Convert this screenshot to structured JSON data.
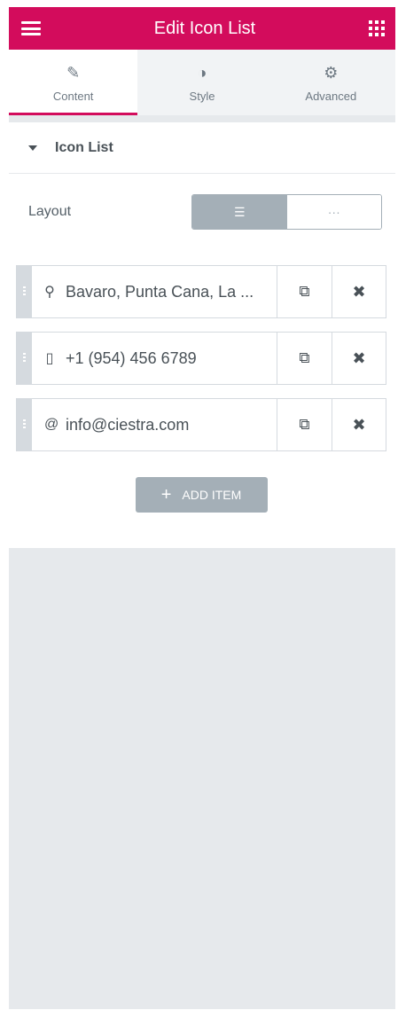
{
  "header": {
    "title": "Edit Icon List",
    "menu_icon": "hamburger-icon",
    "apps_icon": "grid-icon"
  },
  "tabs": [
    {
      "label": "Content",
      "icon": "pencil-icon",
      "active": true
    },
    {
      "label": "Style",
      "icon": "contrast-icon",
      "active": false
    },
    {
      "label": "Advanced",
      "icon": "gear-icon",
      "active": false
    }
  ],
  "section": {
    "title": "Icon List"
  },
  "layout": {
    "label": "Layout",
    "options": [
      {
        "icon": "list-icon",
        "glyph": "☰",
        "active": true
      },
      {
        "icon": "inline-dots-icon",
        "glyph": "···",
        "active": false
      }
    ]
  },
  "items": [
    {
      "icon": "map-marker-icon",
      "glyph": "⚲",
      "text": "Bavaro, Punta Cana, La ..."
    },
    {
      "icon": "mobile-icon",
      "glyph": "▯",
      "text": "+1 (954) 456 6789"
    },
    {
      "icon": "at-icon",
      "glyph": "@",
      "text": "info@ciestra.com"
    }
  ],
  "item_actions": {
    "duplicate_glyph": "⧉",
    "remove_glyph": "✖"
  },
  "add_button": {
    "label": "ADD ITEM",
    "glyph": "+"
  },
  "colors": {
    "accent": "#d30c5c",
    "muted": "#a4afb7",
    "panel_bg": "#e6e9ec"
  }
}
